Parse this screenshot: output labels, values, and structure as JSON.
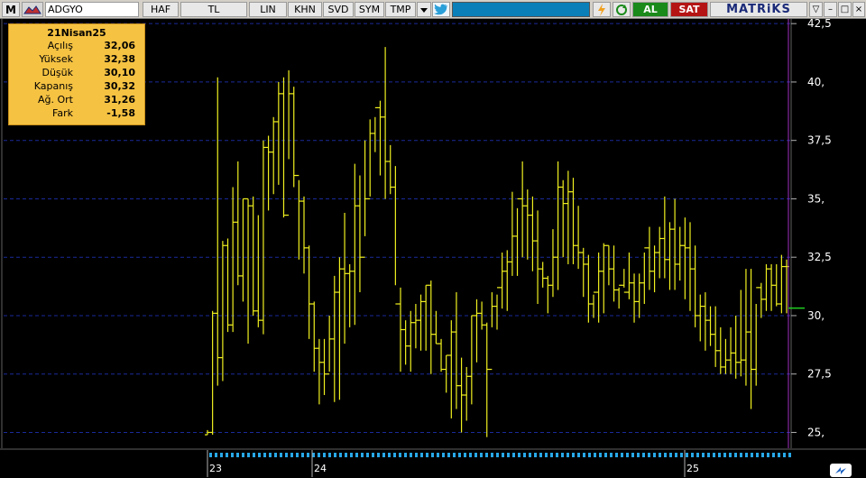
{
  "toolbar": {
    "symbol_menu": "M",
    "symbol": "ADGYO",
    "buttons": [
      "HAF",
      "TL",
      "LIN",
      "KHN",
      "SVD",
      "SYM",
      "TMP"
    ],
    "al_label": "AL",
    "sat_label": "SAT",
    "brand": "MATRiKS",
    "win_controls": [
      "▽",
      "–",
      "□",
      "×"
    ]
  },
  "info_panel": {
    "date": "21Nisan25",
    "rows": [
      {
        "label": "Açılış",
        "value": "32,06"
      },
      {
        "label": "Yüksek",
        "value": "32,38"
      },
      {
        "label": "Düşük",
        "value": "30,10"
      },
      {
        "label": "Kapanış",
        "value": "30,32"
      },
      {
        "label": "Ağ. Ort",
        "value": "31,26"
      },
      {
        "label": "Fark",
        "value": "-1,58"
      }
    ]
  },
  "timeline": {
    "years": [
      "23",
      "24",
      "25"
    ]
  },
  "colors": {
    "bars": "#f0f020",
    "grid": "#1a2a9a",
    "axis_text": "#ffffff",
    "cursor_line": "#a030c0",
    "last_price_line": "#20d020"
  },
  "chart_data": {
    "type": "ohlc",
    "symbol": "ADGYO",
    "y_ticks": [
      "25,",
      "27,5",
      "30,",
      "32,5",
      "35,",
      "37,5",
      "40,",
      "42,5"
    ],
    "y_tick_values": [
      25,
      27.5,
      30,
      32.5,
      35,
      37.5,
      40,
      42.5
    ],
    "ylim": [
      24,
      42.5
    ],
    "last_price": 30.32,
    "bars": [
      [
        24.9,
        25.1,
        24.9,
        25.0
      ],
      [
        25.0,
        30.2,
        24.9,
        30.1
      ],
      [
        30.1,
        40.2,
        27.0,
        28.2
      ],
      [
        28.2,
        33.2,
        27.2,
        33.0
      ],
      [
        33.0,
        33.3,
        29.3,
        29.6
      ],
      [
        29.6,
        35.5,
        29.3,
        34.0
      ],
      [
        34.0,
        36.6,
        31.3,
        31.7
      ],
      [
        31.7,
        35.0,
        30.6,
        35.0
      ],
      [
        35.0,
        35.0,
        28.8,
        34.7
      ],
      [
        34.7,
        35.1,
        30.0,
        30.2
      ],
      [
        30.2,
        34.3,
        29.5,
        29.8
      ],
      [
        29.8,
        37.5,
        29.2,
        37.2
      ],
      [
        37.2,
        37.7,
        34.5,
        37.0
      ],
      [
        37.0,
        38.5,
        35.2,
        38.3
      ],
      [
        38.3,
        40.0,
        35.6,
        39.5
      ],
      [
        39.5,
        40.2,
        34.2,
        34.3
      ],
      [
        34.3,
        40.5,
        36.7,
        39.5
      ],
      [
        39.5,
        39.8,
        35.5,
        36.0
      ],
      [
        36.0,
        35.8,
        32.4,
        34.9
      ],
      [
        34.9,
        35.1,
        31.8,
        32.9
      ],
      [
        32.9,
        33.0,
        29.0,
        30.5
      ],
      [
        30.5,
        30.6,
        27.6,
        28.6
      ],
      [
        28.6,
        29.0,
        26.2,
        28.0
      ],
      [
        28.0,
        29.0,
        26.6,
        27.5
      ],
      [
        27.5,
        30.0,
        27.6,
        29.0
      ],
      [
        29.0,
        31.7,
        26.3,
        31.0
      ],
      [
        31.0,
        32.5,
        26.4,
        32.0
      ],
      [
        32.0,
        34.4,
        28.8,
        31.8
      ],
      [
        31.8,
        32.2,
        29.5,
        31.9
      ],
      [
        31.9,
        36.5,
        29.6,
        34.7
      ],
      [
        34.7,
        36.0,
        31.0,
        32.5
      ],
      [
        32.5,
        37.5,
        33.4,
        35.0
      ],
      [
        35.0,
        38.4,
        35.1,
        37.8
      ],
      [
        37.8,
        38.5,
        37.0,
        38.9
      ],
      [
        38.9,
        39.2,
        36.0,
        38.5
      ],
      [
        38.5,
        41.5,
        35.0,
        36.6
      ],
      [
        36.6,
        37.3,
        35.2,
        35.5
      ],
      [
        35.5,
        36.4,
        31.3,
        30.5
      ],
      [
        30.5,
        31.2,
        27.6,
        29.4
      ],
      [
        29.4,
        29.8,
        27.9,
        28.7
      ],
      [
        28.7,
        30.2,
        27.6,
        29.7
      ],
      [
        29.7,
        30.5,
        28.6,
        29.8
      ],
      [
        29.8,
        30.9,
        28.5,
        30.6
      ],
      [
        30.6,
        31.3,
        28.5,
        31.3
      ],
      [
        31.3,
        31.5,
        27.5,
        29.2
      ],
      [
        29.2,
        30.2,
        28.8,
        28.8
      ],
      [
        28.8,
        29.0,
        27.6,
        27.7
      ],
      [
        27.7,
        28.3,
        26.7,
        28.3
      ],
      [
        28.3,
        29.8,
        25.6,
        29.3
      ],
      [
        29.3,
        31.0,
        26.0,
        27.0
      ],
      [
        27.0,
        28.2,
        25.0,
        26.6
      ],
      [
        26.6,
        27.8,
        25.5,
        27.4
      ],
      [
        27.4,
        30.0,
        26.2,
        30.0
      ],
      [
        30.0,
        30.7,
        28.0,
        30.1
      ],
      [
        30.1,
        30.6,
        29.4,
        29.6
      ],
      [
        29.6,
        29.7,
        24.8,
        27.7
      ],
      [
        27.7,
        31.0,
        29.5,
        30.4
      ],
      [
        30.4,
        30.9,
        29.4,
        31.2
      ],
      [
        31.2,
        32.7,
        30.3,
        31.9
      ],
      [
        31.9,
        32.8,
        30.2,
        32.3
      ],
      [
        32.3,
        35.3,
        31.7,
        33.4
      ],
      [
        33.4,
        34.6,
        31.7,
        35.0
      ],
      [
        35.0,
        36.6,
        32.5,
        34.7
      ],
      [
        34.7,
        35.4,
        32.4,
        34.3
      ],
      [
        34.3,
        35.1,
        31.9,
        33.2
      ],
      [
        33.2,
        34.5,
        30.5,
        32.0
      ],
      [
        32.0,
        32.3,
        31.2,
        31.6
      ],
      [
        31.6,
        31.7,
        30.1,
        31.3
      ],
      [
        31.3,
        33.7,
        30.8,
        32.5
      ],
      [
        32.5,
        36.6,
        31.1,
        35.5
      ],
      [
        35.5,
        35.8,
        32.5,
        34.8
      ],
      [
        34.8,
        36.2,
        32.2,
        35.3
      ],
      [
        35.3,
        35.9,
        32.2,
        33.0
      ],
      [
        33.0,
        34.7,
        32.0,
        32.7
      ],
      [
        32.7,
        32.9,
        30.8,
        32.2
      ],
      [
        32.2,
        32.6,
        29.7,
        30.5
      ],
      [
        30.5,
        30.9,
        29.9,
        31.0
      ],
      [
        31.0,
        32.7,
        29.7,
        31.9
      ],
      [
        31.9,
        33.1,
        30.1,
        33.0
      ],
      [
        33.0,
        33.0,
        31.3,
        32.0
      ],
      [
        32.0,
        33.0,
        30.6,
        31.1
      ],
      [
        31.1,
        31.2,
        30.3,
        31.3
      ],
      [
        31.3,
        32.0,
        31.2,
        31.0
      ],
      [
        31.0,
        32.7,
        30.7,
        31.4
      ],
      [
        31.4,
        31.8,
        29.7,
        30.6
      ],
      [
        30.6,
        31.8,
        29.9,
        31.4
      ],
      [
        31.4,
        32.7,
        30.5,
        32.9
      ],
      [
        32.9,
        33.8,
        31.1,
        31.9
      ],
      [
        31.9,
        33.0,
        31.0,
        32.7
      ],
      [
        32.7,
        33.8,
        31.6,
        33.3
      ],
      [
        33.3,
        35.1,
        31.6,
        32.4
      ],
      [
        32.4,
        34.0,
        31.1,
        33.7
      ],
      [
        33.7,
        35.0,
        31.1,
        32.2
      ],
      [
        32.2,
        33.8,
        31.5,
        33.0
      ],
      [
        33.0,
        34.2,
        30.7,
        32.9
      ],
      [
        32.9,
        34.0,
        30.2,
        32.0
      ],
      [
        32.0,
        33.0,
        29.5,
        30.0
      ],
      [
        30.0,
        30.9,
        28.9,
        30.4
      ],
      [
        30.4,
        31.0,
        28.5,
        29.8
      ],
      [
        29.8,
        30.4,
        28.7,
        29.2
      ],
      [
        29.2,
        30.4,
        27.8,
        28.5
      ],
      [
        28.5,
        29.5,
        27.5,
        27.8
      ],
      [
        27.8,
        29.0,
        27.5,
        28.1
      ],
      [
        28.1,
        29.5,
        27.5,
        28.4
      ],
      [
        28.4,
        30.0,
        27.3,
        28.0
      ],
      [
        28.0,
        31.1,
        27.4,
        28.1
      ],
      [
        28.1,
        32.0,
        27.0,
        29.3
      ],
      [
        29.3,
        32.0,
        26.0,
        27.7
      ],
      [
        27.7,
        30.5,
        27.0,
        31.2
      ],
      [
        31.2,
        31.4,
        29.9,
        30.7
      ],
      [
        30.7,
        32.2,
        30.2,
        32.0
      ],
      [
        32.0,
        32.2,
        30.2,
        31.3
      ],
      [
        31.3,
        32.2,
        30.4,
        30.5
      ],
      [
        30.5,
        32.6,
        30.1,
        32.1
      ],
      [
        32.1,
        32.4,
        30.1,
        32.1
      ]
    ]
  }
}
